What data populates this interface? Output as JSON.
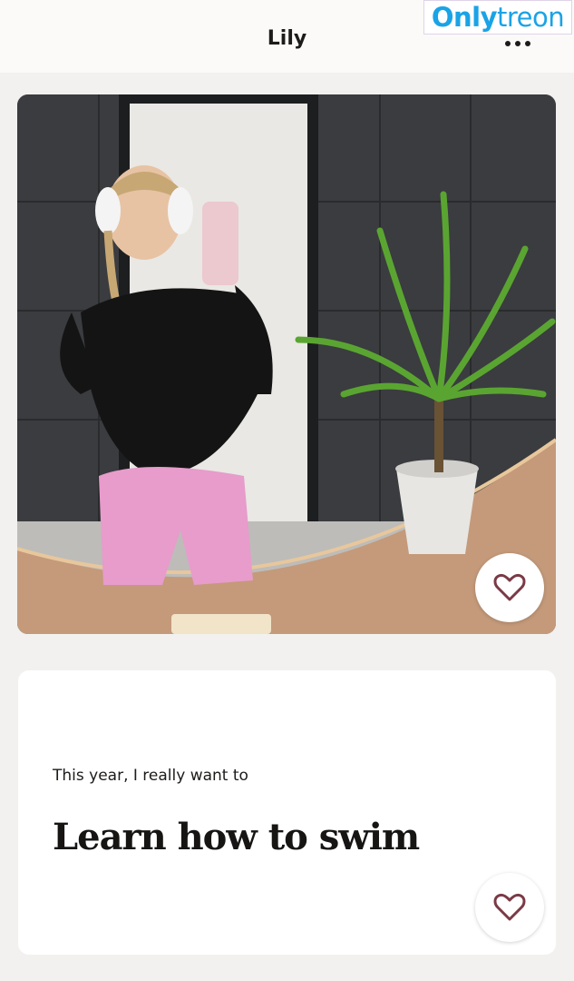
{
  "header": {
    "title": "Lily",
    "more_icon": "more-horizontal-icon"
  },
  "watermark": {
    "part1": "Only",
    "part2": "treon",
    "color": "#1aa3e6"
  },
  "photo": {
    "like_icon": "heart-outline-icon"
  },
  "prompt": {
    "question": "This year, I really want to",
    "answer": "Learn how to swim",
    "like_icon": "heart-outline-icon"
  }
}
